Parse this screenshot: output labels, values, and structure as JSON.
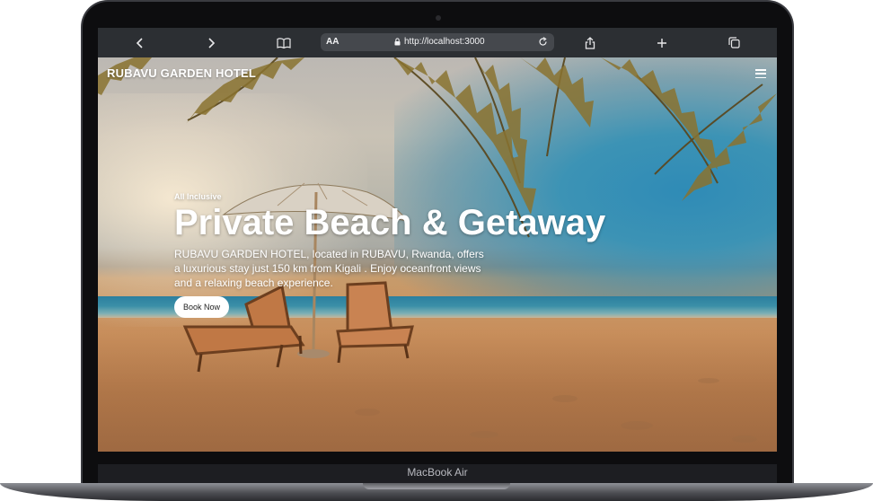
{
  "device": {
    "model_label": "MacBook Air"
  },
  "browser": {
    "text_size_label": "AA",
    "url": "http://localhost:3000",
    "icons": [
      "back-icon",
      "forward-icon",
      "bookmarks-icon",
      "lock-icon",
      "reload-icon",
      "share-icon",
      "plus-icon",
      "tabs-icon"
    ]
  },
  "site": {
    "brand": "RUBAVU GARDEN HOTEL",
    "hero": {
      "eyebrow": "All Inclusive",
      "headline": "Private Beach & Getaway",
      "description": "RUBAVU GARDEN HOTEL, located in RUBAVU, Rwanda, offers a luxurious stay just 150 km from Kigali . Enjoy oceanfront views and a relaxing beach experience.",
      "cta_label": "Book Now"
    }
  },
  "colors": {
    "toolbar": "#2c2f33",
    "address_bar": "#45484d",
    "cta_bg": "#ffffff",
    "sea": "#2c7f9f"
  }
}
